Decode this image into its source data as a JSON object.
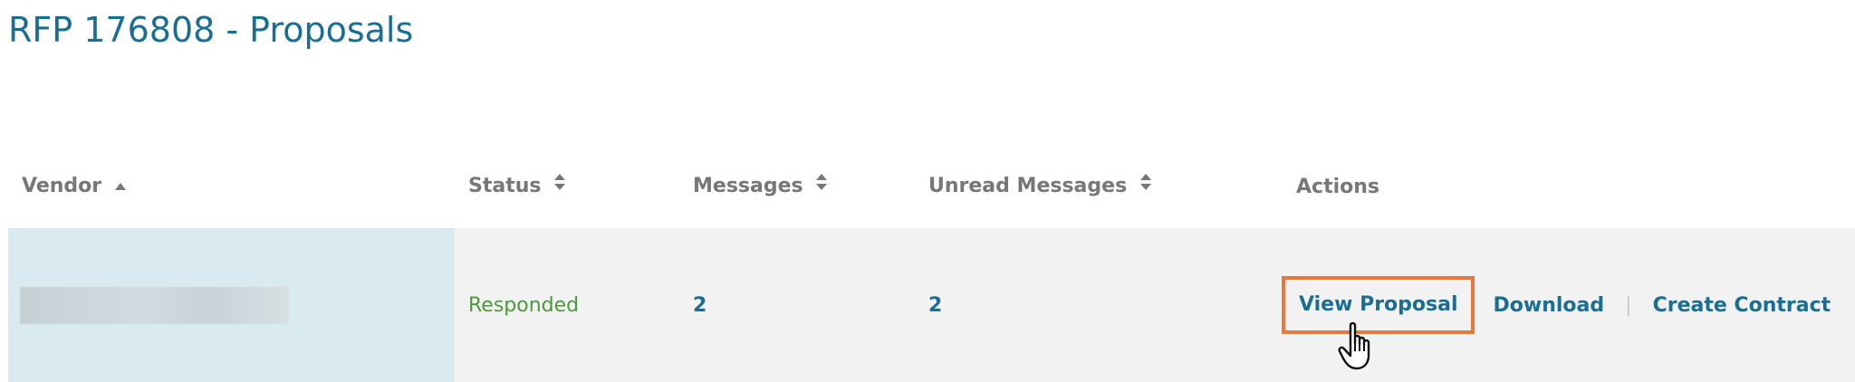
{
  "page": {
    "title": "RFP 176808 - Proposals"
  },
  "table": {
    "columns": [
      {
        "label": "Vendor",
        "sort": "ascending"
      },
      {
        "label": "Status",
        "sort": "unsorted"
      },
      {
        "label": "Messages",
        "sort": "unsorted"
      },
      {
        "label": "Unread Messages",
        "sort": "unsorted"
      },
      {
        "label": "Actions",
        "sort": "none"
      }
    ],
    "rows": [
      {
        "vendor": "",
        "status": "Responded",
        "messages": "2",
        "unread_messages": "2",
        "actions": {
          "view_proposal": "View Proposal",
          "download": "Download",
          "separator": "|",
          "create_contract": "Create Contract"
        }
      }
    ]
  },
  "colors": {
    "title": "#1a6e93",
    "link": "#1a6e93",
    "status_responded": "#4a9a3a",
    "header_text": "#777777",
    "row_background": "#f2f2f2",
    "vendor_cell_background": "#d9eaf0",
    "highlight_border": "#e8773f"
  },
  "icons": {
    "sort_ascending": "caret-up-icon",
    "sort_unsorted": "sort-icon",
    "cursor": "hand-pointer-cursor-icon"
  }
}
